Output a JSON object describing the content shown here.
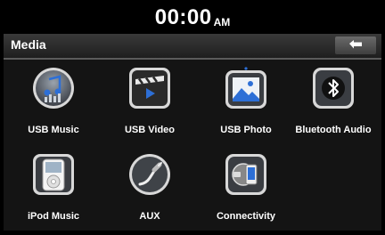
{
  "status": {
    "time": "00:00",
    "ampm": "AM"
  },
  "header": {
    "title": "Media",
    "back_icon": "back-arrow-icon"
  },
  "tiles": [
    {
      "label": "USB Music",
      "icon": "usb-music-icon"
    },
    {
      "label": "USB Video",
      "icon": "usb-video-icon"
    },
    {
      "label": "USB Photo",
      "icon": "usb-photo-icon"
    },
    {
      "label": "Bluetooth Audio",
      "icon": "bluetooth-icon"
    },
    {
      "label": "iPod Music",
      "icon": "ipod-icon"
    },
    {
      "label": "AUX",
      "icon": "aux-cable-icon"
    },
    {
      "label": "Connectivity",
      "icon": "connectivity-icon"
    }
  ],
  "colors": {
    "background": "#000000",
    "screen": "#141414",
    "header": "#2b2b2b",
    "text": "#ffffff"
  }
}
